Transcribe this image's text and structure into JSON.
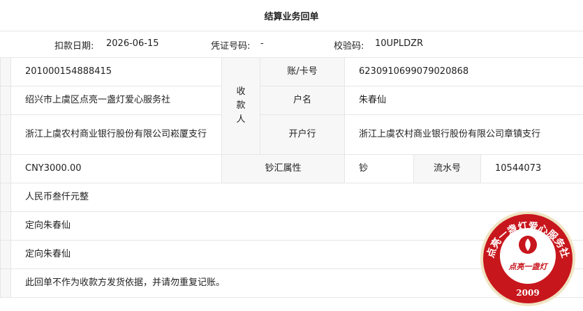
{
  "header": {
    "title": "结算业务回单"
  },
  "meta": {
    "date_label": "扣款日期:",
    "date_value": "2026-06-15",
    "voucher_label": "凭证号码:",
    "voucher_value": "-",
    "check_label": "校验码:",
    "check_value": "10UPLDZR"
  },
  "payer": {
    "account": "201000154888415",
    "name": "绍兴市上虞区点亮一盏灯爱心服务社",
    "bank": "浙江上虞农村商业银行股份有限公司崧厦支行"
  },
  "payee": {
    "group_label": "收款人",
    "account_label": "账/卡号",
    "account_value": "6230910699079020868",
    "name_label": "户名",
    "name_value": "朱春仙",
    "bank_label": "开户行",
    "bank_value": "浙江上虞农村商业银行股份有限公司章镇支行"
  },
  "amount": {
    "value": "CNY3000.00",
    "fx_label": "钞汇属性",
    "fx_value": "钞",
    "serial_label": "流水号",
    "serial_value": "10544073"
  },
  "rows": {
    "amount_words": "人民币叁仟元整",
    "purpose1": "定向朱春仙",
    "purpose2": "定向朱春仙",
    "note": "此回单不作为收款方发货依据，并请勿重复记账。"
  },
  "seal": {
    "ring_text": "点亮一盏灯爱心服务社",
    "inner_text": "点亮一盏灯",
    "year": "2009",
    "color": "#c8161d"
  }
}
